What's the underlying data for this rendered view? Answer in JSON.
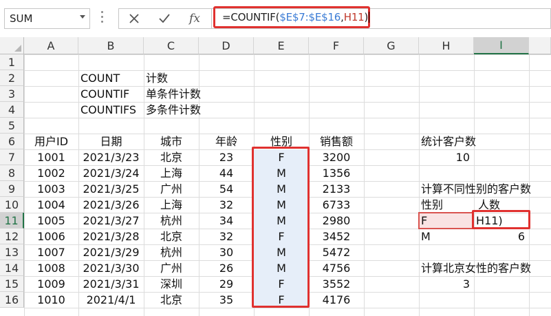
{
  "name_box": {
    "value": "SUM"
  },
  "formula_bar": {
    "cancel_icon": "x-icon",
    "enter_icon": "check-icon",
    "fx_label": "fx",
    "formula_prefix": "=COUNTIF(",
    "formula_ref1": "$E$7:$E$16",
    "formula_sep": ",",
    "formula_ref2": "H11",
    "formula_suffix": ")"
  },
  "columns": [
    "A",
    "B",
    "C",
    "D",
    "E",
    "F",
    "G",
    "H",
    "I"
  ],
  "selected_column": "I",
  "rows": [
    "1",
    "2",
    "3",
    "4",
    "5",
    "6",
    "7",
    "8",
    "9",
    "10",
    "11",
    "12",
    "13",
    "14",
    "15",
    "16"
  ],
  "selected_row": "11",
  "notes": {
    "b2": "COUNT",
    "c2": "计数",
    "b3": "COUNTIF",
    "c3": "单条件计数",
    "b4": "COUNTIFS",
    "c4": "多条件计数"
  },
  "table": {
    "headers": [
      "用户ID",
      "日期",
      "城市",
      "年龄",
      "性别",
      "销售额"
    ],
    "rows": [
      [
        "1001",
        "2021/3/23",
        "北京",
        "23",
        "F",
        "3200"
      ],
      [
        "1002",
        "2021/3/24",
        "上海",
        "44",
        "M",
        "1356"
      ],
      [
        "1003",
        "2021/3/25",
        "广州",
        "54",
        "M",
        "2133"
      ],
      [
        "1004",
        "2021/3/26",
        "上海",
        "32",
        "M",
        "6733"
      ],
      [
        "1005",
        "2021/3/27",
        "杭州",
        "34",
        "M",
        "2980"
      ],
      [
        "1006",
        "2021/3/28",
        "北京",
        "32",
        "F",
        "3452"
      ],
      [
        "1007",
        "2021/3/29",
        "杭州",
        "30",
        "M",
        "5472"
      ],
      [
        "1008",
        "2021/3/30",
        "广州",
        "26",
        "M",
        "4756"
      ],
      [
        "1009",
        "2021/3/31",
        "深圳",
        "29",
        "F",
        "3552"
      ],
      [
        "1010",
        "2021/4/1",
        "北京",
        "35",
        "F",
        "4176"
      ]
    ]
  },
  "summary": {
    "h6": "统计客户数",
    "h7": "10",
    "h9": "计算不同性别的客户数",
    "h10": "性别",
    "i10": "人数",
    "h11": "F",
    "i11": "H11)",
    "h12": "M",
    "i12": "6",
    "h14": "计算北京女性的客户数",
    "h15": "3"
  },
  "colors": {
    "highlight_red": "#e0312f",
    "selection_green": "#217346",
    "range_fill": "#e6eef9"
  }
}
